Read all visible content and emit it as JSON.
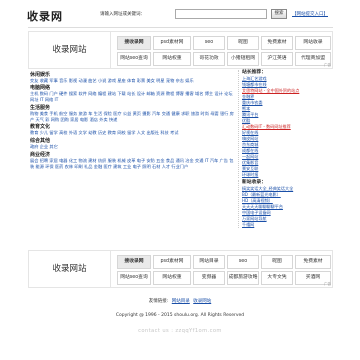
{
  "header": {
    "logo": "收录网",
    "search_label": "请输入网址或关键词：",
    "search_value": "",
    "search_button": "搜索",
    "add_site": "【网站提交入口】"
  },
  "ad_top": {
    "brand": "收录网站",
    "row1": [
      "搜收录网",
      "psd素材网",
      "seo",
      "昵图",
      "免费素材",
      "网站收录"
    ],
    "row2": [
      "网站seo查询",
      "网站权重",
      "哥花功效",
      "小猪短租网",
      "沪江英语",
      "代理商加盟"
    ],
    "tag": "广告"
  },
  "ad_bottom": {
    "brand": "收录网站",
    "row1": [
      "搜收录网",
      "psd素材网",
      "网站目录",
      "seo",
      "昵图",
      "免费素材"
    ],
    "row2": [
      "网站seo查询",
      "网站权重",
      "变频器",
      "成都旅游攻略",
      "大专文凭",
      "买酒网"
    ],
    "tag": "广告"
  },
  "categories": [
    {
      "title": "休闲娱乐",
      "links": "交友 收藏 军事 音乐 影视 动漫 曲艺 小说 游戏 星座 体育 彩票 美女 明星 宠物 杂志 娱乐"
    },
    {
      "title": "电脑网络",
      "links": "主机 数码 门户 硬件 搜索 软件 网络 编程 建站 下载 站长 设计 邮箱 资源 教程 博客 播客 域名 博主 设计 论坛 网址 IT 网络 IT"
    },
    {
      "title": "生活服务",
      "links": "购物 美食 手机 航空 服务 旅游 车 生活 保险 医疗 公益 黄页 摄影 汽车 交通 健康 求职 旅游 时尚 母婴 银行 房产 天气 彩 网购 团购 家居 电影 酒店 外卖 快递"
    },
    {
      "title": "教育文化",
      "links": "教育 少儿 留学 高校 外语 文学 幼教 历史 教育 网校 留学 人文 出版社 科技 考试"
    },
    {
      "title": "综合其他",
      "links": "政府 企业 其它"
    },
    {
      "title": "商业经济",
      "links": "展会 招聘 家居 电器 化工 物流 建材 纺织 服装 机械 皮革 电子 安防 五金 食品 通讯 冶金 交通 IT 汽车 广告 包装 能源 环保 医药 农林 印刷 礼品 金融 医疗 建筑 工业 电子 照明 石材 人才 行业门户"
    }
  ],
  "sidebar": {
    "box1_title": "站长推荐：",
    "box1_items": [
      "上海汇艺游戏",
      "钱塘都市在线",
      "艾思特网站 - 全中国外贸的站点",
      "金融界",
      "重庆市农委",
      "熊本",
      "腾讯平台",
      "优酷",
      "汇动数码IT - 数码网址推荐",
      "好视在线",
      "嗨皮网站",
      "京东商城",
      "成都在线",
      "一起网站",
      "优集影音",
      "景安互联",
      "环球时报"
    ],
    "box2_title": "新站收录：",
    "box2_items": [
      "搞笑笑话大全_经典笑话大全",
      "BD（最新蓝光电影）",
      "HD（高清视频）",
      "天天天天聊聊聊聊平台",
      "中国电子设备网",
      "万家网站导航",
      "千禧网"
    ]
  },
  "footer": {
    "friendlinks_label": "友情链接:",
    "friendlinks": [
      "网站目录",
      "收录网站"
    ],
    "copyright": "Copyright @ 1996 - 2015 shoulu.org. All Rights Reserved",
    "contact": "contact us : zzqqYf1om.com"
  }
}
